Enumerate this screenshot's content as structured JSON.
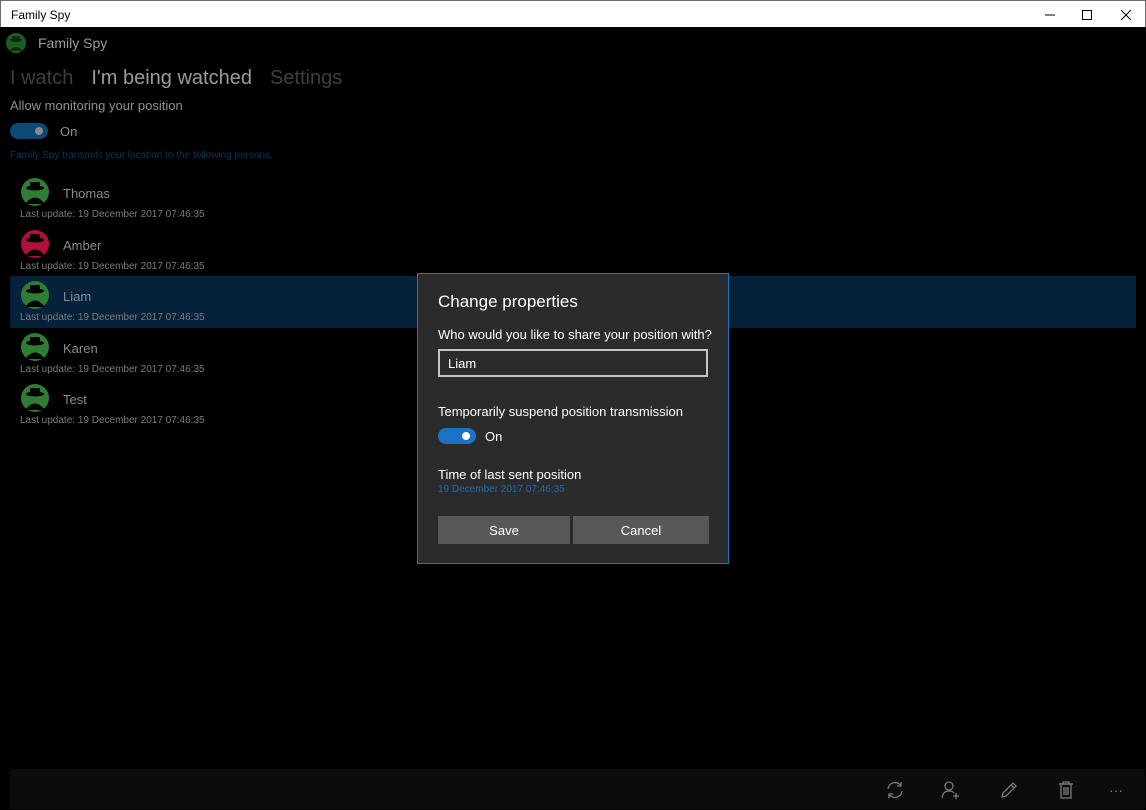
{
  "window": {
    "title": "Family Spy"
  },
  "app": {
    "name": "Family Spy"
  },
  "pivot": {
    "tabs": [
      "I watch",
      "I'm being watched",
      "Settings"
    ],
    "active_index": 1
  },
  "monitoring": {
    "label": "Allow monitoring your position",
    "toggle_state": "On",
    "note": "Family Spy transmits your location to the following persons."
  },
  "persons": [
    {
      "name": "Thomas",
      "updated": "Last update: 19 December 2017 07:46:35",
      "avatar_color": "#2e7d32"
    },
    {
      "name": "Amber",
      "updated": "Last update: 19 December 2017 07:46:35",
      "avatar_color": "#b0103a"
    },
    {
      "name": "Liam",
      "updated": "Last update: 19 December 2017 07:46:35",
      "avatar_color": "#2e7d32"
    },
    {
      "name": "Karen",
      "updated": "Last update: 19 December 2017 07:46:35",
      "avatar_color": "#2e7d32"
    },
    {
      "name": "Test",
      "updated": "Last update: 19 December 2017 07:46:35",
      "avatar_color": "#2e7d32"
    }
  ],
  "selected_person_index": 2,
  "dialog": {
    "title": "Change properties",
    "question": "Who would you like to share your position with?",
    "name_value": "Liam",
    "suspend_label": "Temporarily suspend position transmission",
    "suspend_state": "On",
    "last_sent_label": "Time of last sent position",
    "last_sent_value": "19 December 2017 07:46:35",
    "save_label": "Save",
    "cancel_label": "Cancel"
  },
  "appbar": {
    "icons": [
      "sync-icon",
      "add-person-icon",
      "edit-icon",
      "delete-icon",
      "more-icon"
    ],
    "more_label": "···"
  },
  "colors": {
    "accent": "#1a73c7",
    "dialog_border": "#1a78c2",
    "selected_row": "#06223a"
  }
}
